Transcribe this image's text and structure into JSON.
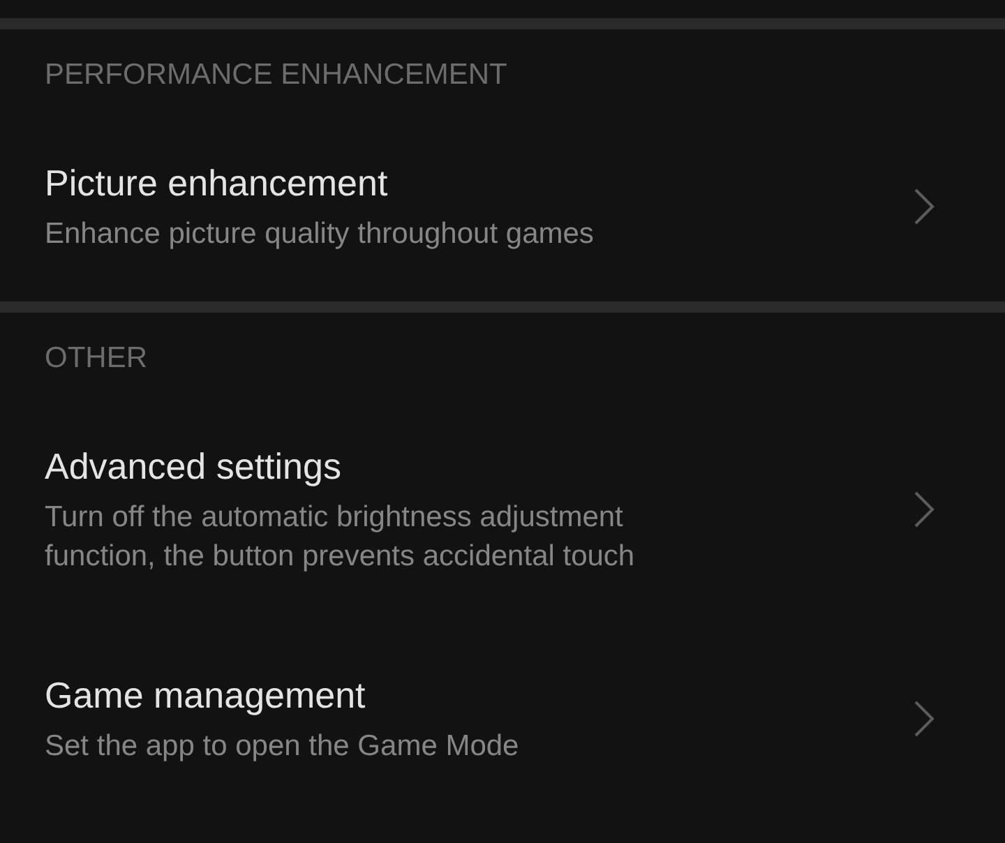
{
  "sections": [
    {
      "header": "PERFORMANCE ENHANCEMENT",
      "items": [
        {
          "title": "Picture enhancement",
          "description": [
            "Enhance picture quality throughout games"
          ]
        }
      ]
    },
    {
      "header": "OTHER",
      "items": [
        {
          "title": "Advanced settings",
          "description": [
            "Turn off the automatic brightness adjustment",
            "function, the button prevents accidental touch"
          ]
        },
        {
          "title": "Game management",
          "description": [
            "Set the app to open the Game Mode"
          ]
        }
      ]
    }
  ]
}
